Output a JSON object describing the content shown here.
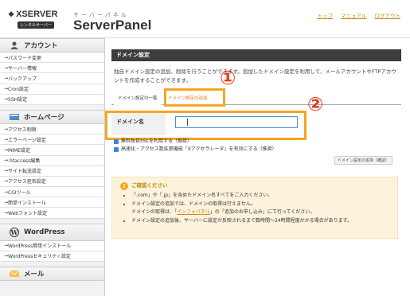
{
  "header": {
    "logo_name": "XSERVER",
    "logo_rental": "レンタルサーバー",
    "logo_kana": "サーバーパネル",
    "logo_title": "ServerPanel",
    "links": [
      "トップ",
      "マニュアル",
      "ログアウト"
    ]
  },
  "sidebar": {
    "account_heading": "アカウント",
    "account_items": [
      "パスワード変更",
      "サーバー情報",
      "バックアップ",
      "Cron設定",
      "SSH設定"
    ],
    "homepage_heading": "ホームページ",
    "homepage_items": [
      "アクセス制限",
      "エラーページ設定",
      "MIME設定",
      ".htaccess編集",
      "サイト転送設定",
      "アクセス拒否設定",
      "CGIツール",
      "簡単インストール",
      "Webフォント設定"
    ],
    "wordpress_heading": "WordPress",
    "wordpress_items": [
      "WordPress簡単インストール",
      "WordPressセキュリティ設定"
    ],
    "mail_heading": "メール"
  },
  "main": {
    "title": "ドメイン設定",
    "description": "独自ドメイン設定の追加、削除を行うことができます。追加したドメイン設定を利用して、メールアカウントやFTPアカウントを作成することができます。",
    "tab_list": "ドメイン設定の一覧",
    "tab_add": "ドメイン設定の追加",
    "marker1": "①",
    "marker2": "②",
    "field_label": "ドメイン名",
    "field_value": "",
    "check1": "無料独自SSLを利用する（推奨）",
    "check2": "高速化・アクセス数拡張機能「Xアクセラレータ」を有効にする（推奨）",
    "confirm_button": "ドメイン設定の追加（確認）",
    "notice_title": "ご確認ください",
    "notice_items": [
      "「.com」や「.jp」を含めたドメイン名すべてをご入力ください。",
      "ドメイン設定の追加では、ドメインの取得は行えません。",
      "ドメインの取得は、「",
      "インフォパネル",
      "」の「追加のお申し込み」にて行ってください。",
      "ドメイン設定の追加後、サーバーに設定が反映されるまで数時間～24時間程度かかる場合があります。"
    ]
  },
  "colors": {
    "accent": "#f5a623",
    "marker": "#e63c1f",
    "title_bar": "#3d3d3d",
    "link": "#c58a12"
  }
}
